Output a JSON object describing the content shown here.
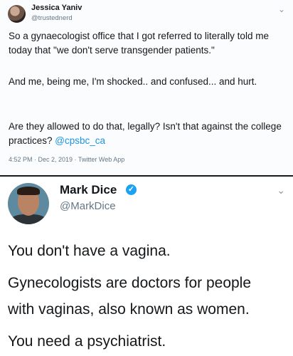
{
  "tweet1": {
    "name": "Jessica Yaniv",
    "handle": "@trustednerd",
    "paragraph1": "So a gynaecologist office that I got referred to literally told me today that \"we don't serve transgender patients.\"",
    "paragraph2": "And me, being me, I'm shocked.. and confused... and hurt.",
    "paragraph3_text": "Are they allowed to do that, legally? Isn't that against the college practices?",
    "paragraph3_mention": "@cpsbc_ca",
    "meta": "4:52 PM · Dec 2, 2019 · Twitter Web App",
    "menu_icon": "chevron-down-icon"
  },
  "tweet2": {
    "name": "Mark Dice",
    "handle": "@MarkDice",
    "verified_icon": "verified-badge-icon",
    "menu_icon": "chevron-down-icon",
    "line1": "You don't have a vagina.",
    "line2": "Gynecologists are doctors for people",
    "line3": "with vaginas, also known as women.",
    "line4": "You need a psychiatrist."
  },
  "colors": {
    "link": "#1b95e0",
    "verified": "#1da1f2",
    "secondary_text": "#657786"
  }
}
